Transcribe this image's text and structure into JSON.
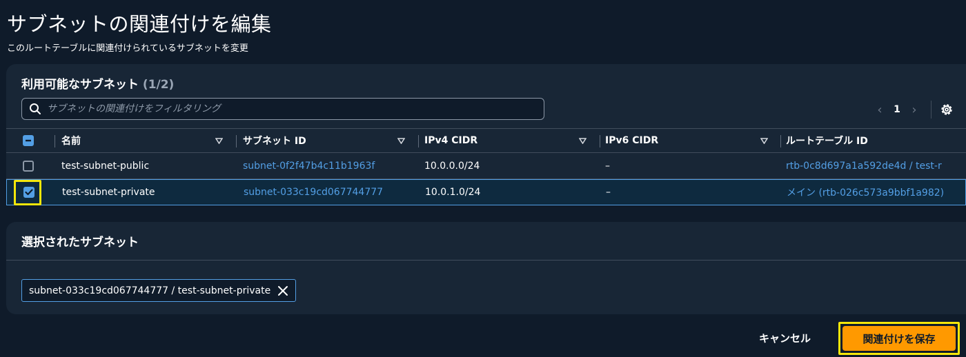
{
  "page": {
    "title": "サブネットの関連付けを編集",
    "subtitle": "このルートテーブルに関連付けられているサブネットを変更"
  },
  "available": {
    "title": "利用可能なサブネット",
    "count": "(1/2)",
    "filter_placeholder": "サブネットの関連付けをフィルタリング",
    "page_number": "1",
    "columns": {
      "name": "名前",
      "subnet_id": "サブネット ID",
      "ipv4": "IPv4 CIDR",
      "ipv6": "IPv6 CIDR",
      "route_table": "ルートテーブル ID"
    },
    "rows": [
      {
        "selected": false,
        "name": "test-subnet-public",
        "subnet_id": "subnet-0f2f47b4c11b1963f",
        "ipv4": "10.0.0.0/24",
        "ipv6": "–",
        "route_table": "rtb-0c8d697a1a592de4d / test-r"
      },
      {
        "selected": true,
        "name": "test-subnet-private",
        "subnet_id": "subnet-033c19cd067744777",
        "ipv4": "10.0.1.0/24",
        "ipv6": "–",
        "route_table": "メイン (rtb-026c573a9bbf1a982)"
      }
    ]
  },
  "selected_panel": {
    "title": "選択されたサブネット",
    "token": "subnet-033c19cd067744777 / test-subnet-private"
  },
  "footer": {
    "cancel": "キャンセル",
    "save": "関連付けを保存"
  },
  "colors": {
    "background": "#0f1b2a",
    "panel": "#182636",
    "link": "#539fe5",
    "primary_button": "#ff9900",
    "highlight": "#f5e70a"
  }
}
